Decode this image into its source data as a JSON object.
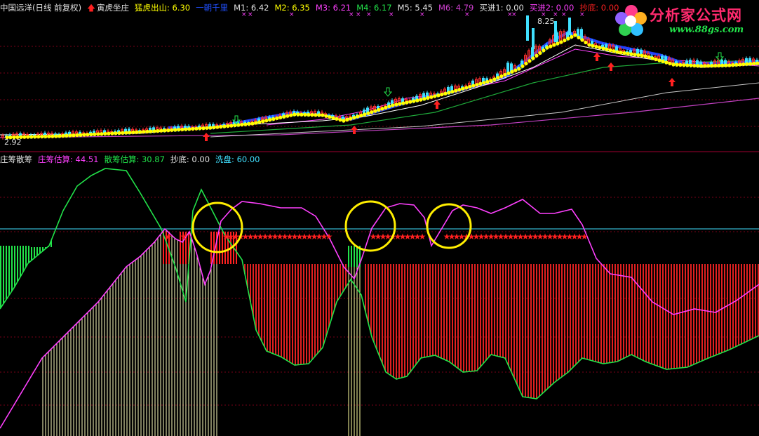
{
  "header": {
    "stock": "中国远洋(日线 前复权)",
    "up_marker": "寅虎坐庄",
    "mhcs": "猛虎出山: 6.30",
    "yjql": "一朝千里",
    "m1": "M1: 6.42",
    "m2": "M2: 6.35",
    "m3": "M3: 6.21",
    "m4": "M4: 6.17",
    "m5": "M5: 5.45",
    "m6": "M6: 4.79",
    "buy1": "买进1: 0.00",
    "buy2": "买进2: 0.00",
    "bottom": "抄底: 0.00"
  },
  "price_labels": {
    "high": "8.25",
    "low": "2.92"
  },
  "subpanel": {
    "title": "庄筹散筹",
    "zcgs": "庄筹估算: 44.51",
    "scgs": "散筹估算: 30.87",
    "bottom": "抄底: 0.00",
    "xp": "洗盘: 60.00"
  },
  "logo": {
    "brand": "分析家公式网",
    "url": "www.88gs.com"
  },
  "colors": {
    "text": "#e0e0e0",
    "red": "#ff2020",
    "yellow": "#ffff00",
    "green": "#22e34a",
    "magenta": "#ff40ff",
    "cyan": "#40e0ff",
    "blue": "#2040ff",
    "white": "#ffffff",
    "panel_border": "#a00030",
    "ref_line": "#40e0ff"
  }
}
